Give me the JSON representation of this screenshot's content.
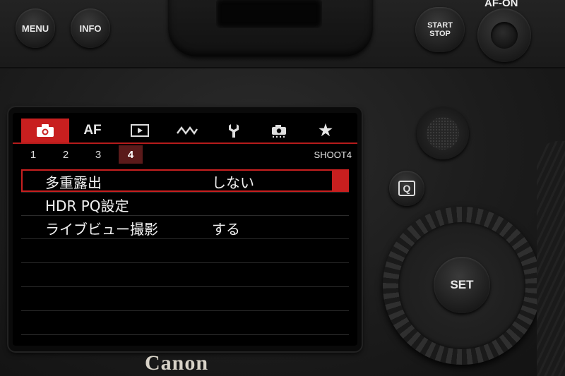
{
  "camera": {
    "brand": "Canon",
    "buttons": {
      "menu": "MENU",
      "info": "INFO",
      "start_stop": "START STOP",
      "af_on": "AF-ON",
      "set": "SET",
      "quick": "Q"
    }
  },
  "screen": {
    "tabs": [
      {
        "label": "📷",
        "icon": "camera-icon",
        "active": true
      },
      {
        "label": "AF",
        "icon": "af-text",
        "active": false
      },
      {
        "label": "▶",
        "icon": "playback-icon",
        "active": false
      },
      {
        "label": "〰",
        "icon": "wave-icon",
        "active": false
      },
      {
        "label": "🔧",
        "icon": "wrench-icon",
        "active": false
      },
      {
        "label": "🎥",
        "icon": "custom-camera-icon",
        "active": false
      },
      {
        "label": "★",
        "icon": "star-icon",
        "active": false
      }
    ],
    "pages": [
      "1",
      "2",
      "3",
      "4"
    ],
    "active_page": "4",
    "page_label": "SHOOT4",
    "menu_items": [
      {
        "label": "多重露出",
        "value": "しない"
      },
      {
        "label": "HDR PQ設定",
        "value": ""
      },
      {
        "label": "ライブビュー撮影",
        "value": "する"
      }
    ]
  },
  "colors": {
    "accent": "#c81f1f",
    "screen_bg": "#000000",
    "body": "#1c1c1c"
  }
}
